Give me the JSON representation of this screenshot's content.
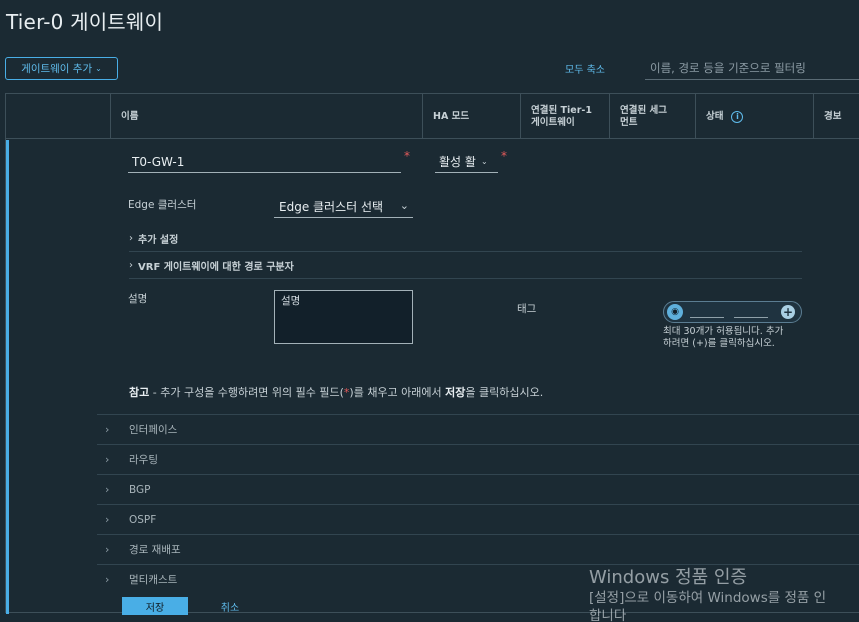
{
  "page": {
    "title": "Tier-0 게이트웨이"
  },
  "toolbar": {
    "add_gateway_label": "게이트웨이 추가",
    "collapse_all_label": "모두 축소",
    "filter_placeholder": "이름, 경로 등을 기준으로 필터링"
  },
  "table": {
    "columns": {
      "name": "이름",
      "ha_mode": "HA 모드",
      "linked_tier1_line1": "연결된 Tier-1",
      "linked_tier1_line2": "게이트웨이",
      "linked_segments_line1": "연결된 세그",
      "linked_segments_line2": "먼트",
      "status": "상태",
      "alarms": "경보"
    }
  },
  "form": {
    "name_value": "T0-GW-1",
    "required_mark": "*",
    "ha_mode_value": "활성 활",
    "edge_cluster_label": "Edge 클러스터",
    "edge_cluster_value": "Edge 클러스터 선택",
    "additional_settings_label": "추가 설정",
    "vrf_label": "VRF 게이트웨이에 대한 경로 구분자",
    "description_label": "설명",
    "description_placeholder": "설명",
    "tags_label": "태그",
    "tags_hint_line1": "최대 30개가 허용됩니다. 추가",
    "tags_hint_line2": "하려면 (+)를 클릭하십시오.",
    "note_prefix": "참고",
    "note_text_1": " - 추가 구성을 수행하려면 위의 필수 필드(",
    "note_star": "*",
    "note_text_2": ")를 채우고 아래에서 ",
    "note_save": "저장",
    "note_text_3": "을 클릭하십시오."
  },
  "sections": [
    {
      "label": "인터페이스"
    },
    {
      "label": "라우팅"
    },
    {
      "label": "BGP"
    },
    {
      "label": "OSPF"
    },
    {
      "label": "경로 재배포"
    },
    {
      "label": "멀티캐스트"
    }
  ],
  "actions": {
    "save_label": "저장",
    "cancel_label": "취소"
  },
  "watermark": {
    "line1": "Windows 정품 인증",
    "line2": "[설정]으로 이동하여 Windows를 정품 인",
    "line3": "합니다"
  },
  "colors": {
    "accent": "#49aee6",
    "background": "#1b2a33",
    "required": "#e45b5b"
  }
}
